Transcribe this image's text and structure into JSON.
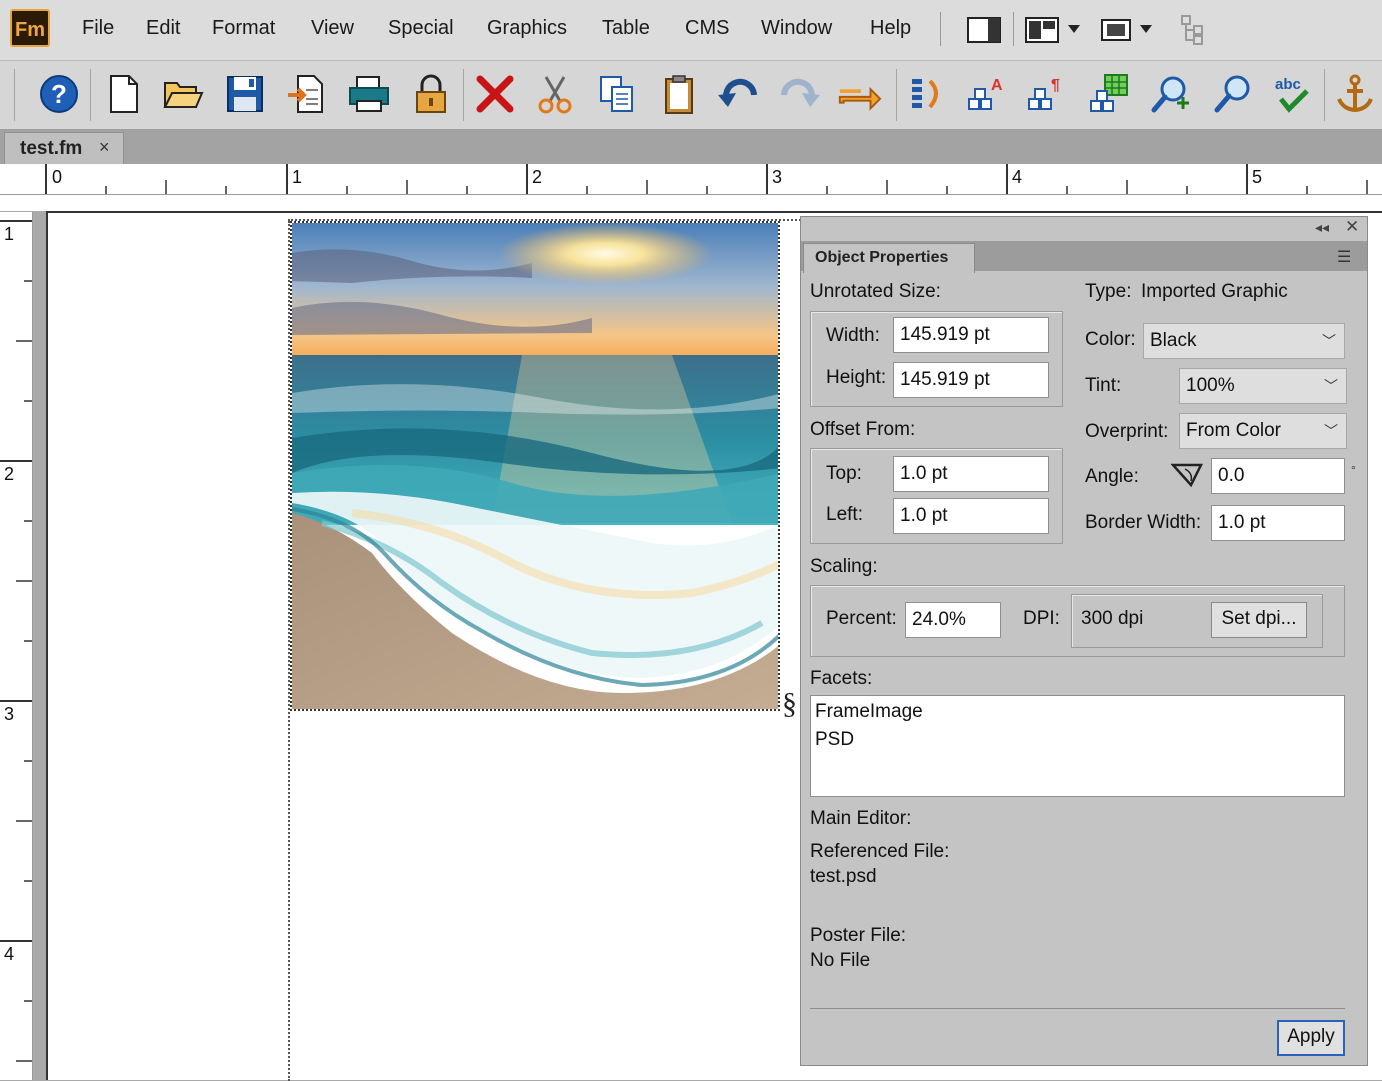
{
  "app": {
    "logo": "Fm"
  },
  "menu": [
    "File",
    "Edit",
    "Format",
    "View",
    "Special",
    "Graphics",
    "Table",
    "CMS",
    "Window",
    "Help"
  ],
  "toolbar_icons": [
    "help-icon",
    "new-document-icon",
    "open-folder-icon",
    "save-icon",
    "import-icon",
    "print-icon",
    "lock-icon",
    "delete-icon",
    "cut-icon",
    "copy-icon",
    "paste-icon",
    "undo-icon",
    "redo-icon",
    "forward-icon",
    "text-flow-icon",
    "character-format-icon",
    "paragraph-format-icon",
    "table-icon",
    "find-icon",
    "search-icon",
    "spelling-check-icon",
    "anchor-icon"
  ],
  "tab": {
    "label": "test.fm",
    "close": "×"
  },
  "hruler": {
    "labels": [
      "0",
      "1",
      "2",
      "3",
      "4",
      "5"
    ]
  },
  "vruler": {
    "labels": [
      "1",
      "2",
      "3",
      "4"
    ]
  },
  "anchor_symbol": "§",
  "panel": {
    "title": "Object Properties",
    "unrotated_size_label": "Unrotated Size:",
    "type_label": "Type:",
    "type_value": "Imported Graphic",
    "width_label": "Width:",
    "width_value": "145.919 pt",
    "height_label": "Height:",
    "height_value": "145.919 pt",
    "color_label": "Color:",
    "color_value": "Black",
    "tint_label": "Tint:",
    "tint_value": "100%",
    "overprint_label": "Overprint:",
    "overprint_value": "From Color",
    "offset_label": "Offset From:",
    "top_label": "Top:",
    "top_value": "1.0 pt",
    "left_label": "Left:",
    "left_value": "1.0 pt",
    "angle_label": "Angle:",
    "angle_value": "0.0",
    "degree": "°",
    "border_label": "Border Width:",
    "border_value": "1.0 pt",
    "scaling_label": "Scaling:",
    "percent_label": "Percent:",
    "percent_value": "24.0%",
    "dpi_label": "DPI:",
    "dpi_value": "300 dpi",
    "set_dpi_label": "Set dpi...",
    "facets_label": "Facets:",
    "facets": [
      "FrameImage",
      "PSD"
    ],
    "main_editor_label": "Main Editor:",
    "referenced_file_label": "Referenced File:",
    "referenced_file_value": "test.psd",
    "poster_file_label": "Poster File:",
    "poster_file_value": "No File",
    "apply_label": "Apply"
  }
}
